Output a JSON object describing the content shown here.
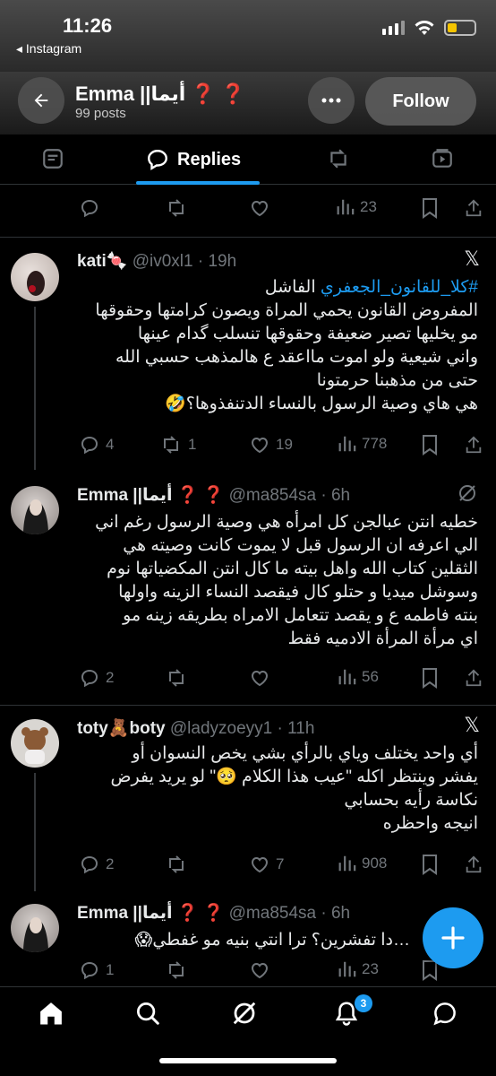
{
  "status_bar": {
    "time": "11:26",
    "back_app": "◂ Instagram"
  },
  "header": {
    "name": "Emma ||أيما",
    "name_marks": "❓ ❓",
    "posts": "99 posts",
    "follow_label": "Follow"
  },
  "tabs": {
    "replies": "Replies"
  },
  "top_actions": {
    "views": "23"
  },
  "tweets": [
    {
      "name": "kati",
      "emoji": "🍬",
      "handle": "@iv0xl1",
      "time": "· 19h",
      "hashtag": "#كلا_للقانون_الجعفري",
      "text_after_hashtag": " الفاشل",
      "body": "المفروض القانون يحمي المراة ويصون كرامتها وحقوقها\nمو يخليها تصير ضعيفة وحقوقها تنسلب گدام عينها\nواني شيعية ولو اموت مااعقد ع هالمذهب حسبي الله\nحتى من مذهبنا حرمتونا\nهي هاي وصية الرسول بالنساء الدتنفذوها؟🤣",
      "replies": "4",
      "retweets": "1",
      "likes": "19",
      "views": "778"
    },
    {
      "name": "Emma ||أيما",
      "marks": "❓ ❓",
      "handle": "@ma854sa",
      "time": "· 6h",
      "body": "خطيه انتن عبالجن كل امرأه هي وصية الرسول رغم اني\nالي اعرفه ان الرسول قبل لا يموت كانت وصيته هي\nالثقلين كتاب الله واهل بيته ما كال انتن المكضياتها نوم\nوسوشل ميديا و حتلو كال فيقصد النساء الزينه واولها\nبنته فاطمه ع و يقصد تتعامل الامراه بطريقه زينه مو\nاي مرأة المرأة الادميه فقط",
      "replies": "2",
      "retweets": "",
      "likes": "",
      "views": "56"
    },
    {
      "name": "toty",
      "emoji": "🧸",
      "name2": "boty",
      "handle": "@ladyzoeyy1",
      "time": "· 11h",
      "body": "أي واحد يختلف وياي بالرأي بشي يخص النسوان أو\nيفشر وينتظر اكله \"عيب هذا الكلام 🥺\" لو يريد يفرض\nنكاسة رأيه بحسابي\nانيجه واحظره",
      "replies": "2",
      "retweets": "",
      "likes": "7",
      "views": "908"
    },
    {
      "name": "Emma ||أيما",
      "marks": "❓ ❓",
      "handle": "@ma854sa",
      "time": "· 6h",
      "body": "…دا تفشرين؟ ترا انتي بنيه مو غفطي😱",
      "replies": "1",
      "retweets": "",
      "likes": "",
      "views": "23"
    }
  ],
  "bottom_nav": {
    "notifications_badge": "3"
  },
  "colors": {
    "accent": "#1d9bf0",
    "background": "#000000",
    "muted": "#71767b",
    "red_mark": "#d0181f"
  },
  "icons": [
    "back-arrow-icon",
    "more-icon",
    "posts-icon",
    "replies-icon",
    "highlights-icon",
    "media-icon",
    "reply-icon",
    "retweet-icon",
    "like-icon",
    "views-icon",
    "bookmark-icon",
    "share-icon",
    "x-logo-icon",
    "grok-icon",
    "home-icon",
    "search-icon",
    "notifications-icon",
    "messages-icon",
    "compose-icon"
  ]
}
